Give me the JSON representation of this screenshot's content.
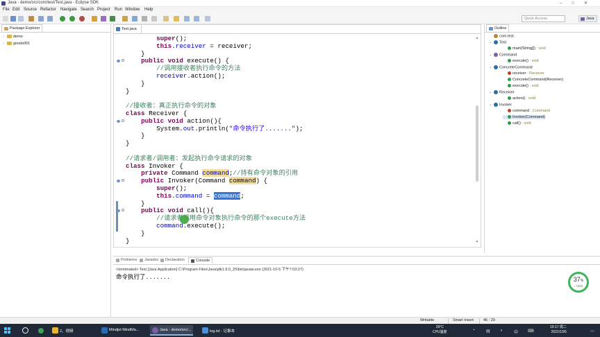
{
  "window": {
    "title": "Java - demo/src/com/test/Test.java - Eclipse SDK",
    "controls": [
      "–",
      "□",
      "✕"
    ]
  },
  "menu": [
    "File",
    "Edit",
    "Source",
    "Refactor",
    "Navigate",
    "Search",
    "Project",
    "Run",
    "Window",
    "Help"
  ],
  "toolbar": {
    "quick_access_placeholder": "Quick Access",
    "perspective": "Java"
  },
  "package_explorer": {
    "title": "Package Explorer",
    "projects": [
      "demo",
      "goods001"
    ]
  },
  "editor": {
    "tab_label": "Test.java",
    "code_lines": [
      [
        [
          "",
          "        "
        ],
        [
          "kw",
          "super"
        ],
        [
          "",
          "();"
        ]
      ],
      [
        [
          "",
          "        "
        ],
        [
          "kw",
          "this"
        ],
        [
          "",
          "."
        ],
        [
          "fld",
          "receiver"
        ],
        [
          "",
          " = receiver;"
        ]
      ],
      [
        [
          "",
          "    }"
        ]
      ],
      [
        [
          "",
          "    "
        ],
        [
          "kw",
          "public"
        ],
        [
          "",
          " "
        ],
        [
          "kw",
          "void"
        ],
        [
          "",
          " execute() {"
        ]
      ],
      [
        [
          "",
          "        "
        ],
        [
          "cm",
          "//调用接收者执行命令的方法"
        ]
      ],
      [
        [
          "",
          "        "
        ],
        [
          "fld",
          "receiver"
        ],
        [
          "",
          ".action();"
        ]
      ],
      [
        [
          "",
          "    }"
        ]
      ],
      [
        [
          "",
          "}"
        ]
      ],
      [
        [
          "",
          ""
        ]
      ],
      [
        [
          "cm",
          "//接收者：真正执行命令的对象"
        ]
      ],
      [
        [
          "kw",
          "class"
        ],
        [
          "",
          " Receiver {"
        ]
      ],
      [
        [
          "",
          "    "
        ],
        [
          "kw",
          "public"
        ],
        [
          "",
          " "
        ],
        [
          "kw",
          "void"
        ],
        [
          "",
          " action(){"
        ]
      ],
      [
        [
          "",
          "        System."
        ],
        [
          "fld",
          "out"
        ],
        [
          "",
          ".println("
        ],
        [
          "str",
          "\"命令执行了.......\""
        ],
        [
          "",
          ");"
        ]
      ],
      [
        [
          "",
          "    }"
        ]
      ],
      [
        [
          "",
          "}"
        ]
      ],
      [
        [
          "",
          ""
        ]
      ],
      [
        [
          "cm",
          "//请求者/调用者：发起执行命令请求的对象"
        ]
      ],
      [
        [
          "kw",
          "class"
        ],
        [
          "",
          " Invoker {"
        ]
      ],
      [
        [
          "",
          "    "
        ],
        [
          "kw",
          "private"
        ],
        [
          "",
          " Command "
        ],
        [
          "fld occ",
          "command"
        ],
        [
          "",
          ";"
        ],
        [
          "cm",
          "//持有命令对象的引用"
        ]
      ],
      [
        [
          "",
          "    "
        ],
        [
          "kw",
          "public"
        ],
        [
          "",
          " Invoker(Command "
        ],
        [
          "occ",
          "command"
        ],
        [
          "",
          ") {"
        ]
      ],
      [
        [
          "",
          "        "
        ],
        [
          "kw",
          "super"
        ],
        [
          "",
          "();"
        ]
      ],
      [
        [
          "",
          "        "
        ],
        [
          "kw",
          "this"
        ],
        [
          "",
          "."
        ],
        [
          "fld",
          "command"
        ],
        [
          "",
          " = "
        ],
        [
          "sel",
          "command"
        ],
        [
          "",
          ";"
        ]
      ],
      [
        [
          "",
          "    }"
        ]
      ],
      [
        [
          "",
          "    "
        ],
        [
          "kw",
          "public"
        ],
        [
          "",
          " "
        ],
        [
          "kw",
          "void"
        ],
        [
          "",
          " call(){"
        ]
      ],
      [
        [
          "",
          "        "
        ],
        [
          "cm",
          "//请求者调用命令对象执行命令的那个execute方法"
        ]
      ],
      [
        [
          "",
          "        "
        ],
        [
          "fld",
          "command"
        ],
        [
          "",
          ".execute();"
        ]
      ],
      [
        [
          "",
          "    }"
        ]
      ],
      [
        [
          "",
          "}"
        ]
      ]
    ]
  },
  "outline": {
    "title": "Outline",
    "items": [
      {
        "label": "com.test",
        "detail": "",
        "indent": 0,
        "kind": "package"
      },
      {
        "label": "Test",
        "detail": "",
        "indent": 0,
        "kind": "class"
      },
      {
        "label": "main(String[])",
        "detail": " : void",
        "indent": 1,
        "kind": "method-static"
      },
      {
        "label": "Command",
        "detail": "",
        "indent": 0,
        "kind": "interface"
      },
      {
        "label": "execute()",
        "detail": " : void",
        "indent": 1,
        "kind": "method"
      },
      {
        "label": "ConcreteCommand",
        "detail": "",
        "indent": 0,
        "kind": "class"
      },
      {
        "label": "receiver",
        "detail": " : Receiver",
        "indent": 1,
        "kind": "field"
      },
      {
        "label": "ConcreteCommand(Receiver)",
        "detail": "",
        "indent": 1,
        "kind": "ctor"
      },
      {
        "label": "execute()",
        "detail": " : void",
        "indent": 1,
        "kind": "method"
      },
      {
        "label": "Receiver",
        "detail": "",
        "indent": 0,
        "kind": "class"
      },
      {
        "label": "action()",
        "detail": " : void",
        "indent": 1,
        "kind": "method"
      },
      {
        "label": "Invoker",
        "detail": "",
        "indent": 0,
        "kind": "class"
      },
      {
        "label": "command",
        "detail": " : Command",
        "indent": 1,
        "kind": "field"
      },
      {
        "label": "Invoker(Command)",
        "detail": "",
        "indent": 1,
        "kind": "ctor",
        "selected": true
      },
      {
        "label": "call()",
        "detail": " : void",
        "indent": 1,
        "kind": "method"
      }
    ]
  },
  "bottom_panel": {
    "tabs": [
      "Problems",
      "Javadoc",
      "Declaration",
      "Console"
    ],
    "active_tab": "Console",
    "terminated": "<terminated> Test [Java Application] C:\\Program Files\\Java\\jdk1.8.0_25\\bin\\javaw.exe (2021-10-5 下午7:03:27)",
    "output": "命令执行了......."
  },
  "monitor": {
    "percent": "37",
    "sub": "↑ 0K/s"
  },
  "statusbar": {
    "writable": "Writable",
    "insert_mode": "Smart Insert",
    "position": "46 : 29"
  },
  "taskbar": {
    "items": [
      {
        "label": "2、视频",
        "color": "#f0b429"
      },
      {
        "label": "Mindjet MindMa...",
        "color": "#2b6cb0"
      },
      {
        "label": "Java - demo/src/...",
        "color": "#7b5ea7"
      },
      {
        "label": "log.txt - 记事本",
        "color": "#4a90d9"
      }
    ],
    "weather_temp": "29°C",
    "weather_label": "CPU温度",
    "time": "19:17",
    "weekday": "周二",
    "date": "2021/10/5",
    "colors": {
      "bar": "#1f2937",
      "accent": "#8fb3e6"
    }
  },
  "colors": {
    "keyword": "#7f0055",
    "field": "#0000c0",
    "comment": "#3f7f5f",
    "string": "#2a00ff",
    "occurrence": "#f3dca0",
    "selection": "#3875d7"
  }
}
